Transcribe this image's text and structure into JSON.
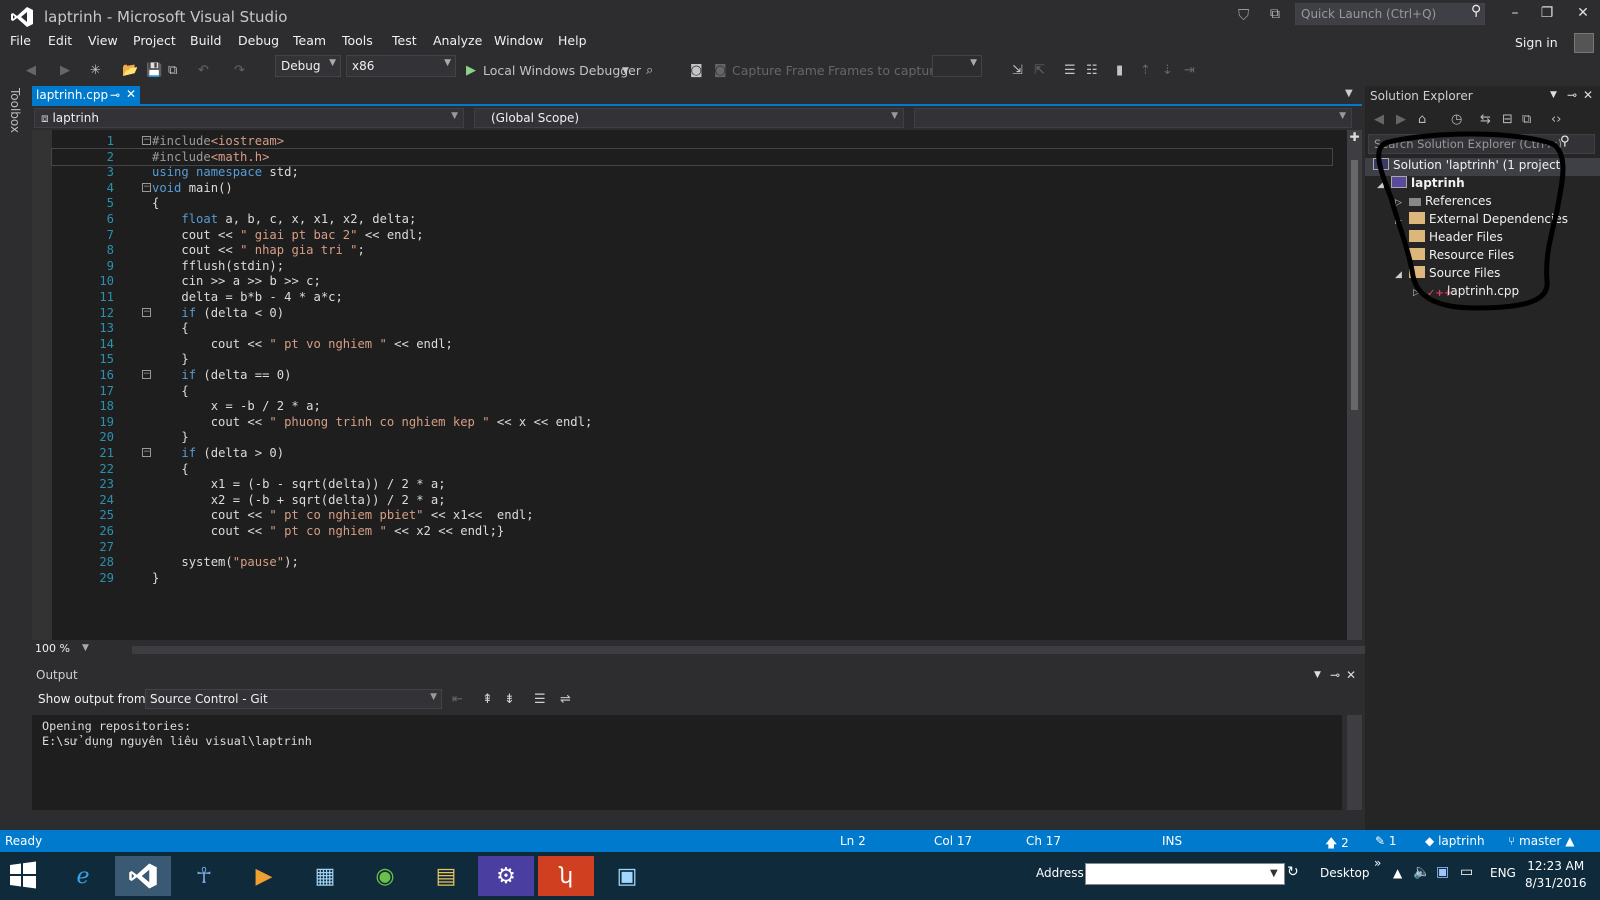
{
  "window": {
    "title": "laptrinh - Microsoft Visual Studio",
    "quick_launch_placeholder": "Quick Launch (Ctrl+Q)",
    "sign_in": "Sign in"
  },
  "menu": [
    "File",
    "Edit",
    "View",
    "Project",
    "Build",
    "Debug",
    "Team",
    "Tools",
    "Test",
    "Analyze",
    "Window",
    "Help"
  ],
  "toolbar": {
    "config": "Debug",
    "platform": "x86",
    "debugger": "Local Windows Debugger",
    "capture_frame": "Capture Frame",
    "frames_to_capture": "Frames to capture:"
  },
  "toolbox_label": "Toolbox",
  "editor": {
    "tab": "laptrinh.cpp",
    "nav_project": "laptrinh",
    "nav_scope": "(Global Scope)",
    "zoom": "100 %",
    "lines": [
      "#include<iostream>",
      "#include<math.h>",
      "using namespace std;",
      "void main()",
      "{",
      "    float a, b, c, x, x1, x2, delta;",
      "    cout << \" giai pt bac 2\" << endl;",
      "    cout << \" nhap gia tri \";",
      "    fflush(stdin);",
      "    cin >> a >> b >> c;",
      "    delta = b*b - 4 * a*c;",
      "    if (delta < 0)",
      "    {",
      "        cout << \" pt vo nghiem \" << endl;",
      "    }",
      "    if (delta == 0)",
      "    {",
      "        x = -b / 2 * a;",
      "        cout << \" phuong trinh co nghiem kep \" << x << endl;",
      "    }",
      "    if (delta > 0)",
      "    {",
      "        x1 = (-b - sqrt(delta)) / 2 * a;",
      "        x2 = (-b + sqrt(delta)) / 2 * a;",
      "        cout << \" pt co nghiem pbiet\" << x1<<  endl;",
      "        cout << \" pt co nghiem \" << x2 << endl;}",
      "",
      "    system(\"pause\");",
      "}"
    ]
  },
  "output": {
    "title": "Output",
    "show_from_label": "Show output from:",
    "source": "Source Control - Git",
    "text": [
      "Opening repositories:",
      "E:\\sử dụng nguyên liêu visual\\laptrinh"
    ]
  },
  "solution_explorer": {
    "title": "Solution Explorer",
    "search_placeholder": "Search Solution Explorer (Ctrl+;)",
    "items": [
      {
        "label": "Solution 'laptrinh' (1 project)"
      },
      {
        "label": "laptrinh"
      },
      {
        "label": "References"
      },
      {
        "label": "External Dependencies"
      },
      {
        "label": "Header Files"
      },
      {
        "label": "Resource Files"
      },
      {
        "label": "Source Files"
      },
      {
        "label": "laptrinh.cpp"
      }
    ]
  },
  "status": {
    "ready": "Ready",
    "ln": "Ln 2",
    "col": "Col 17",
    "ch": "Ch 17",
    "ins": "INS",
    "up": "2",
    "edits": "1",
    "repo": "laptrinh",
    "branch": "master"
  },
  "taskbar": {
    "address_label": "Address",
    "desktop": "Desktop",
    "lang": "ENG",
    "time": "12:23 AM",
    "date": "8/31/2016"
  },
  "colors": {
    "accent": "#007acc",
    "keyword": "#569cd6",
    "string": "#d69d85",
    "line_number": "#2b91af"
  }
}
